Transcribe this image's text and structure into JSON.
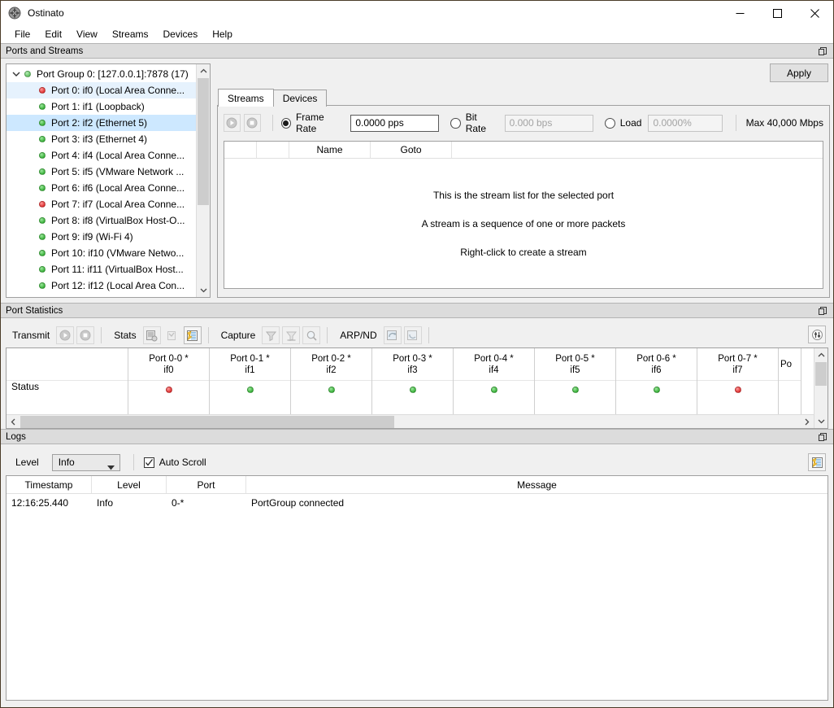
{
  "window": {
    "title": "Ostinato",
    "app_icon": "ostinato-logo-icon",
    "minimize": "minimize-icon",
    "maximize": "maximize-icon",
    "close": "close-icon"
  },
  "menubar": {
    "items": [
      "File",
      "Edit",
      "View",
      "Streams",
      "Devices",
      "Help"
    ]
  },
  "ports_and_streams": {
    "dock_title": "Ports and Streams",
    "tree": {
      "group": {
        "label": "Port Group 0:  [127.0.0.1]:7878 (17)",
        "status": "green"
      },
      "ports": [
        {
          "label": "Port 0: if0 (Local Area Conne...",
          "status": "red",
          "state": "focused"
        },
        {
          "label": "Port 1: if1 (Loopback)",
          "status": "green",
          "state": "normal"
        },
        {
          "label": "Port 2: if2 (Ethernet 5)",
          "status": "green",
          "state": "selected"
        },
        {
          "label": "Port 3: if3 (Ethernet 4)",
          "status": "green",
          "state": "normal"
        },
        {
          "label": "Port 4: if4 (Local Area Conne...",
          "status": "green",
          "state": "normal"
        },
        {
          "label": "Port 5: if5 (VMware Network ...",
          "status": "green",
          "state": "normal"
        },
        {
          "label": "Port 6: if6 (Local Area Conne...",
          "status": "green",
          "state": "normal"
        },
        {
          "label": "Port 7: if7 (Local Area Conne...",
          "status": "red",
          "state": "normal"
        },
        {
          "label": "Port 8: if8 (VirtualBox Host-O...",
          "status": "green",
          "state": "normal"
        },
        {
          "label": "Port 9: if9 (Wi-Fi 4)",
          "status": "green",
          "state": "normal"
        },
        {
          "label": "Port 10: if10 (VMware Netwo...",
          "status": "green",
          "state": "normal"
        },
        {
          "label": "Port 11: if11 (VirtualBox Host...",
          "status": "green",
          "state": "normal"
        },
        {
          "label": "Port 12: if12 (Local Area Con...",
          "status": "green",
          "state": "normal"
        }
      ]
    },
    "apply_label": "Apply",
    "tabs": [
      {
        "label": "Streams",
        "active": true
      },
      {
        "label": "Devices",
        "active": false
      }
    ],
    "rate_bar": {
      "start_icon": "play-icon",
      "stop_icon": "stop-icon",
      "frame_rate": {
        "label": "Frame Rate",
        "selected": true,
        "value": "0.0000 pps",
        "enabled": true
      },
      "bit_rate": {
        "label": "Bit Rate",
        "selected": false,
        "value": "0.000 bps",
        "enabled": false
      },
      "load": {
        "label": "Load",
        "selected": false,
        "value": "0.0000%",
        "enabled": false
      },
      "max_label": "Max 40,000 Mbps"
    },
    "stream_table": {
      "columns": [
        "",
        "",
        "Name",
        "Goto",
        ""
      ],
      "empty_messages": [
        "This is the stream list for the selected port",
        "A stream is a sequence of one or more packets",
        "Right-click to create a stream"
      ]
    }
  },
  "port_statistics": {
    "dock_title": "Port Statistics",
    "toolbar": {
      "transmit_label": "Transmit",
      "transmit_buttons": [
        {
          "icon": "play-icon",
          "name": "start-transmit-button",
          "enabled": false
        },
        {
          "icon": "stop-icon",
          "name": "stop-transmit-button",
          "enabled": false
        }
      ],
      "stats_label": "Stats",
      "stats_buttons": [
        {
          "icon": "clear-stats-icon",
          "name": "clear-stats-button",
          "enabled": false
        },
        {
          "icon": "clear-all-stats-icon",
          "name": "clear-all-stats-button",
          "enabled": false
        },
        {
          "icon": "resolve-stats-icon",
          "name": "port-stats-filter-button",
          "enabled": true
        }
      ],
      "capture_label": "Capture",
      "capture_buttons": [
        {
          "icon": "start-capture-icon",
          "name": "start-capture-button",
          "enabled": false
        },
        {
          "icon": "stop-capture-icon",
          "name": "stop-capture-button",
          "enabled": false
        },
        {
          "icon": "view-capture-icon",
          "name": "view-capture-button",
          "enabled": false
        }
      ],
      "arpnd_label": "ARP/ND",
      "arpnd_buttons": [
        {
          "icon": "resolve-neighbors-icon",
          "name": "resolve-neighbors-button",
          "enabled": false
        },
        {
          "icon": "clear-neighbors-icon",
          "name": "clear-neighbors-button",
          "enabled": false
        }
      ],
      "settings_icon": "stats-filter-icon"
    },
    "grid": {
      "row_labels": [
        "Status"
      ],
      "columns": [
        {
          "title": "Port 0-0 *",
          "sub": "if0",
          "status": "red"
        },
        {
          "title": "Port 0-1 *",
          "sub": "if1",
          "status": "green"
        },
        {
          "title": "Port 0-2 *",
          "sub": "if2",
          "status": "green"
        },
        {
          "title": "Port 0-3 *",
          "sub": "if3",
          "status": "green"
        },
        {
          "title": "Port 0-4 *",
          "sub": "if4",
          "status": "green"
        },
        {
          "title": "Port 0-5 *",
          "sub": "if5",
          "status": "green"
        },
        {
          "title": "Port 0-6 *",
          "sub": "if6",
          "status": "green"
        },
        {
          "title": "Port 0-7 *",
          "sub": "if7",
          "status": "red"
        }
      ],
      "partial_column": {
        "title": "Po",
        "sub": "",
        "status": ""
      }
    }
  },
  "logs": {
    "dock_title": "Logs",
    "level_label": "Level",
    "level_value": "Info",
    "auto_scroll_label": "Auto Scroll",
    "auto_scroll_checked": true,
    "clear_log_icon": "clear-log-icon",
    "columns": [
      "Timestamp",
      "Level",
      "Port",
      "Message"
    ],
    "rows": [
      {
        "timestamp": "12:16:25.440",
        "level": "Info",
        "port": "0-*",
        "message": "PortGroup connected"
      }
    ]
  },
  "colors": {
    "status_green": "#3cb33c",
    "status_red": "#e03434",
    "selection": "#cde8ff",
    "panel": "#f0f0f0",
    "dock_header": "#dcdcdc"
  }
}
